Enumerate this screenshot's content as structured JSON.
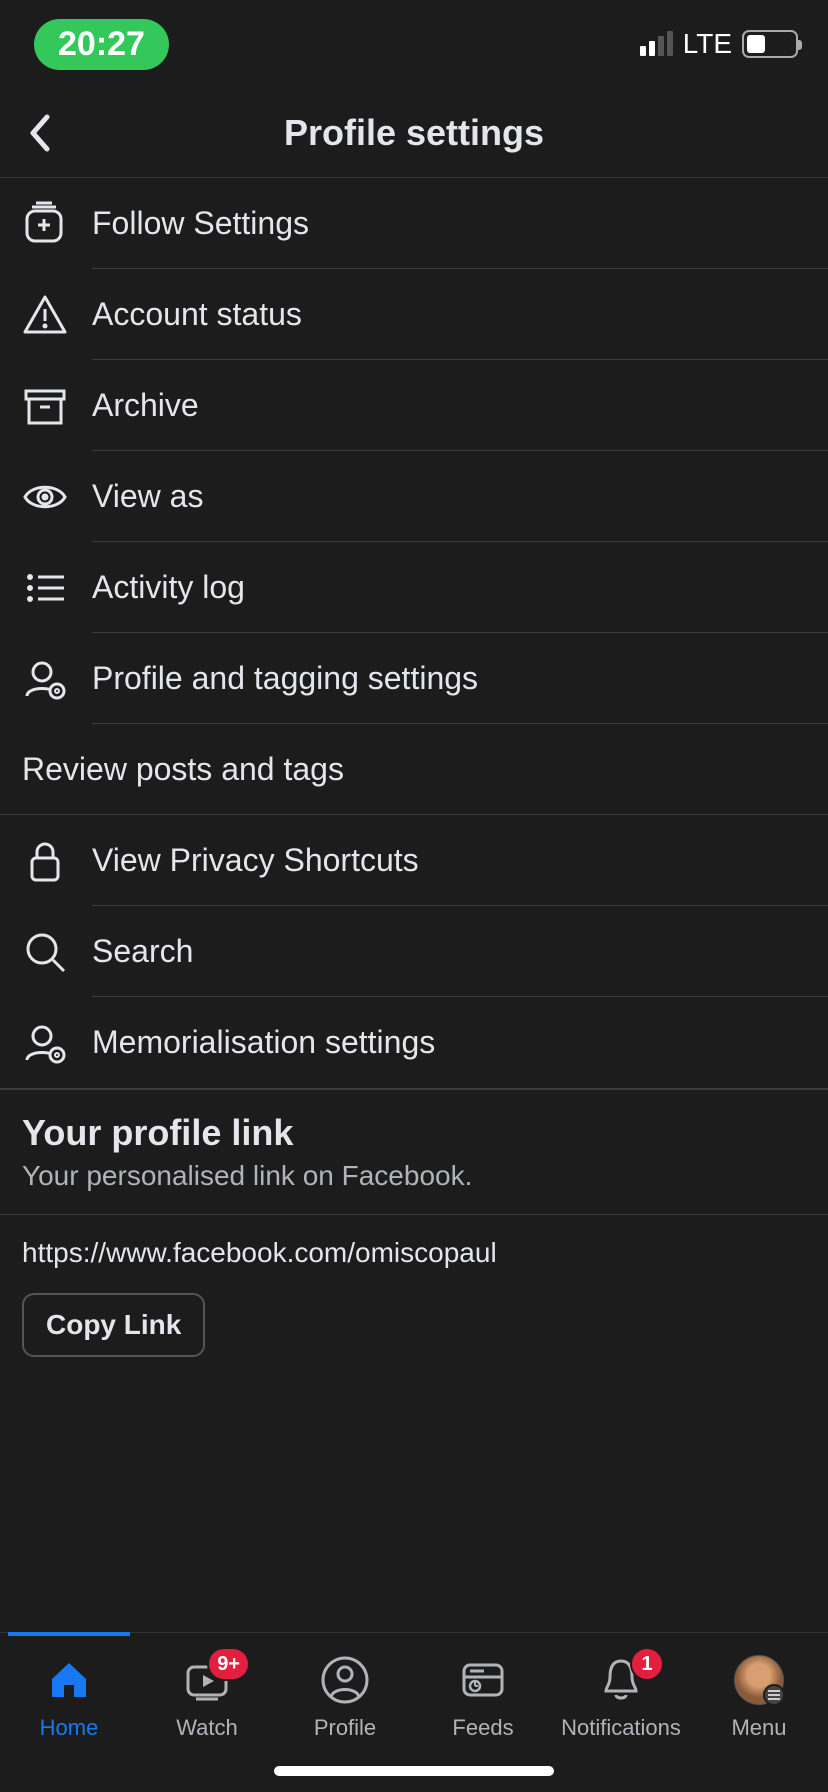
{
  "status": {
    "time": "20:27",
    "network": "LTE"
  },
  "header": {
    "title": "Profile settings"
  },
  "items": [
    {
      "label": "Follow Settings",
      "icon": "follow"
    },
    {
      "label": "Account status",
      "icon": "warning"
    },
    {
      "label": "Archive",
      "icon": "archive"
    },
    {
      "label": "View as",
      "icon": "eye"
    },
    {
      "label": "Activity log",
      "icon": "list"
    },
    {
      "label": "Profile and tagging settings",
      "icon": "profile-gear"
    }
  ],
  "section_label": "Review posts and tags",
  "items2": [
    {
      "label": "View Privacy Shortcuts",
      "icon": "lock"
    },
    {
      "label": "Search",
      "icon": "search"
    },
    {
      "label": "Memorialisation settings",
      "icon": "profile-gear"
    }
  ],
  "profile_link": {
    "title": "Your profile link",
    "subtitle": "Your personalised link on Facebook.",
    "url": "https://www.facebook.com/omiscopaul",
    "copy_label": "Copy Link"
  },
  "nav": {
    "home": "Home",
    "watch": "Watch",
    "profile": "Profile",
    "feeds": "Feeds",
    "notifications": "Notifications",
    "menu": "Menu",
    "watch_badge": "9+",
    "notif_badge": "1"
  }
}
